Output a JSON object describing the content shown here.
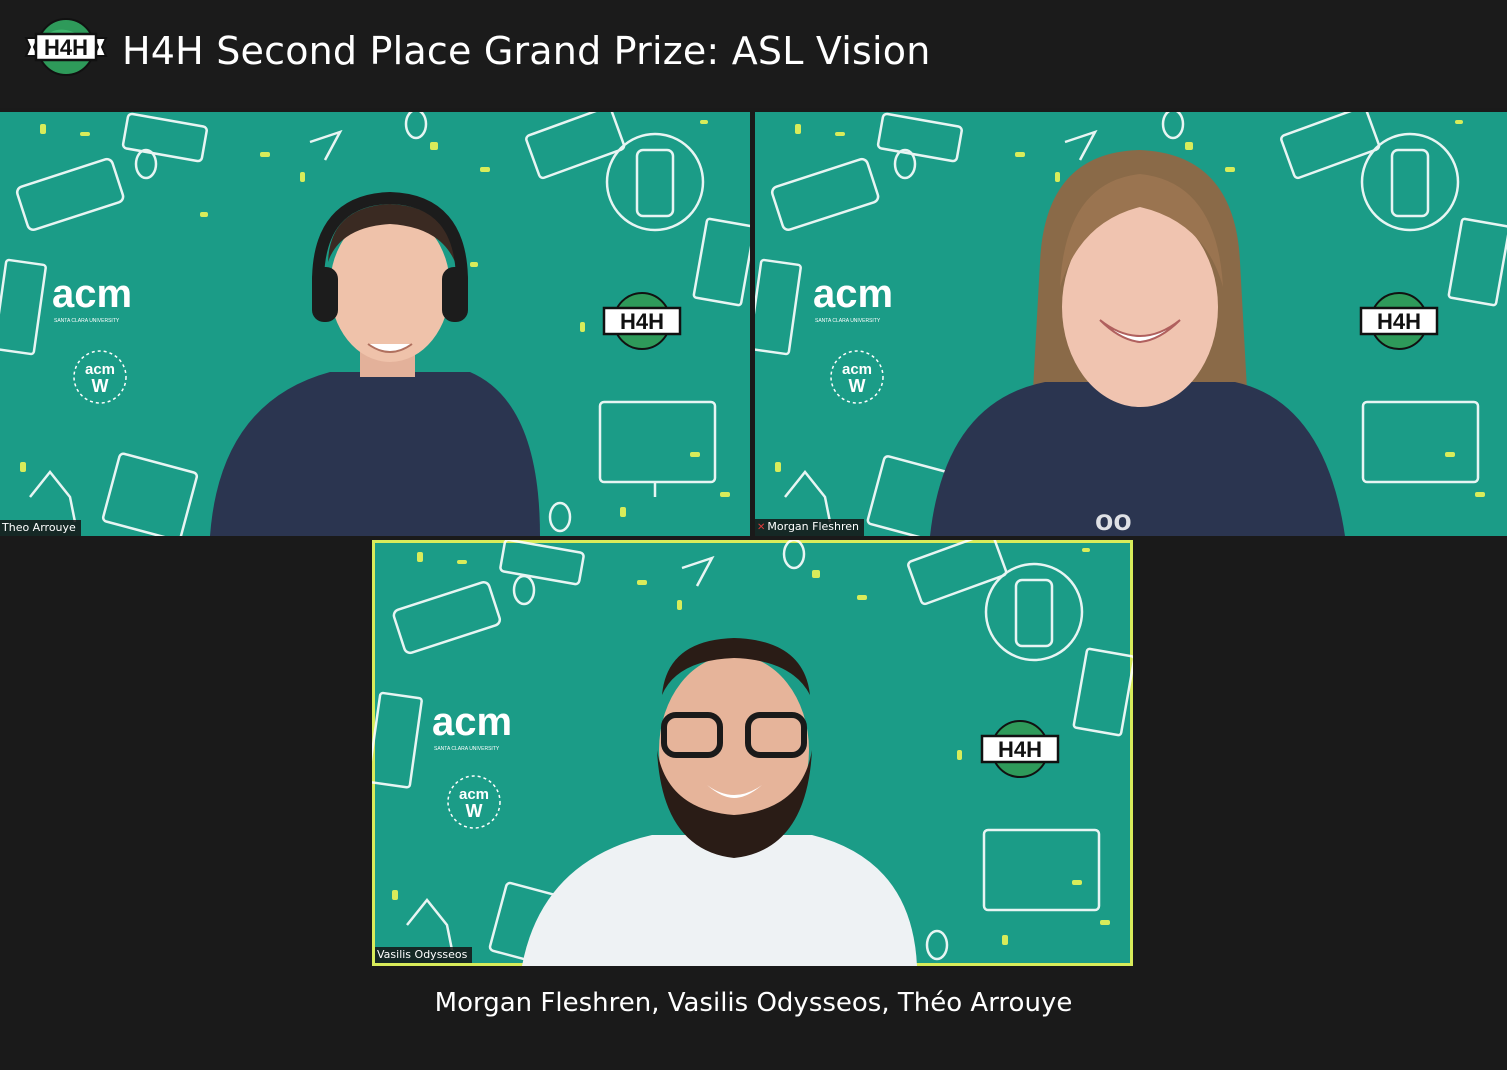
{
  "header": {
    "logo_text": "H4H",
    "title": "H4H Second Place Grand Prize: ASL Vision"
  },
  "tiles": [
    {
      "name": "Theo Arrouye",
      "muted": false,
      "active": false,
      "person": "young man with headphones, navy shirt"
    },
    {
      "name": "Morgan Fleshren",
      "muted": true,
      "active": false,
      "person": "woman with long hair, navy shirt"
    },
    {
      "name": "Vasilis Odysseos",
      "muted": false,
      "active": true,
      "person": "man with beard and glasses, white shirt"
    }
  ],
  "background": {
    "brand_text": "acm",
    "sub_text": "SANTA CLARA UNIVERSITY",
    "acmw_text": "acm W",
    "logo_text": "H4H"
  },
  "caption": "Morgan Fleshren, Vasilis Odysseos, Théo Arrouye",
  "colors": {
    "tile_bg": "#1b9c87",
    "active_border": "#d8ec5a",
    "page_bg": "#1a1a1a"
  }
}
